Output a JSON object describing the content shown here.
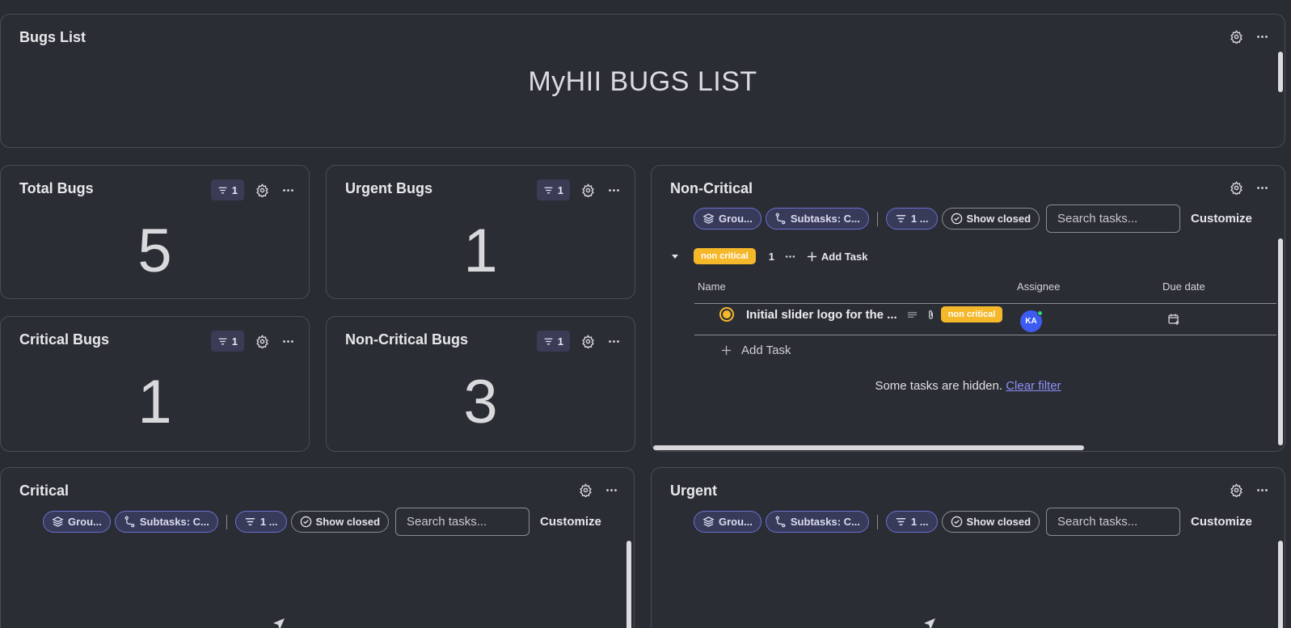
{
  "bugs_list": {
    "title": "Bugs List",
    "heading": "MyHII BUGS LIST"
  },
  "stats": [
    {
      "title": "Total Bugs",
      "filter_count": "1",
      "value": "5"
    },
    {
      "title": "Urgent Bugs",
      "filter_count": "1",
      "value": "1"
    },
    {
      "title": "Critical Bugs",
      "filter_count": "1",
      "value": "1"
    },
    {
      "title": "Non-Critical Bugs",
      "filter_count": "1",
      "value": "3"
    }
  ],
  "toolbar": {
    "group_label": "Grou...",
    "subtasks_label": "Subtasks: C...",
    "filter_label": "1 ...",
    "show_closed_label": "Show closed",
    "search_placeholder": "Search tasks...",
    "customize_label": "Customize"
  },
  "non_critical": {
    "title": "Non-Critical",
    "group": {
      "tag": "non critical",
      "count": "1",
      "add_task_label": "Add Task"
    },
    "columns": [
      "Name",
      "Assignee",
      "Due date"
    ],
    "tasks": [
      {
        "name": "Initial slider logo for the ...",
        "tag": "non critical",
        "assignee": "KA"
      }
    ],
    "add_task_label": "Add Task",
    "hidden_text": "Some tasks are hidden.",
    "clear_filter_label": "Clear filter"
  },
  "critical": {
    "title": "Critical"
  },
  "urgent": {
    "title": "Urgent"
  },
  "colors": {
    "background": "#2a2c33",
    "accent": "#6b6fd0",
    "status_tag": "#f5b82a",
    "avatar": "#3d5bf0",
    "link": "#8e8ff8"
  }
}
